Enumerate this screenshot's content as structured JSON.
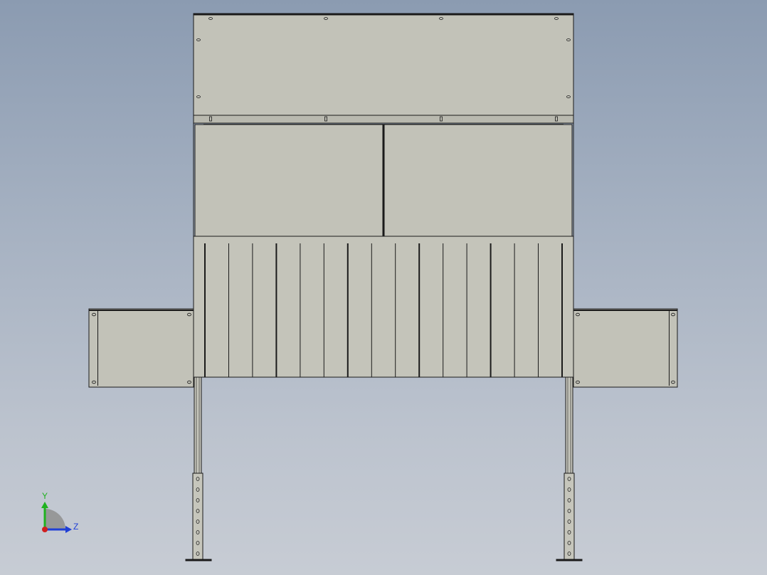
{
  "view": {
    "background_top": "#8b9bb1",
    "background_bottom": "#c7ccd4",
    "model": {
      "panel_fill": "#c2c2b8",
      "panel_fill_dark": "#b5b5ab",
      "edge_color": "#1a1a1a",
      "fin_count": 16
    },
    "triad": {
      "y_label": "Y",
      "z_label": "Z",
      "y_color": "#1fb21f",
      "z_color": "#1f3fd6",
      "x_color": "#d01f1f"
    }
  }
}
